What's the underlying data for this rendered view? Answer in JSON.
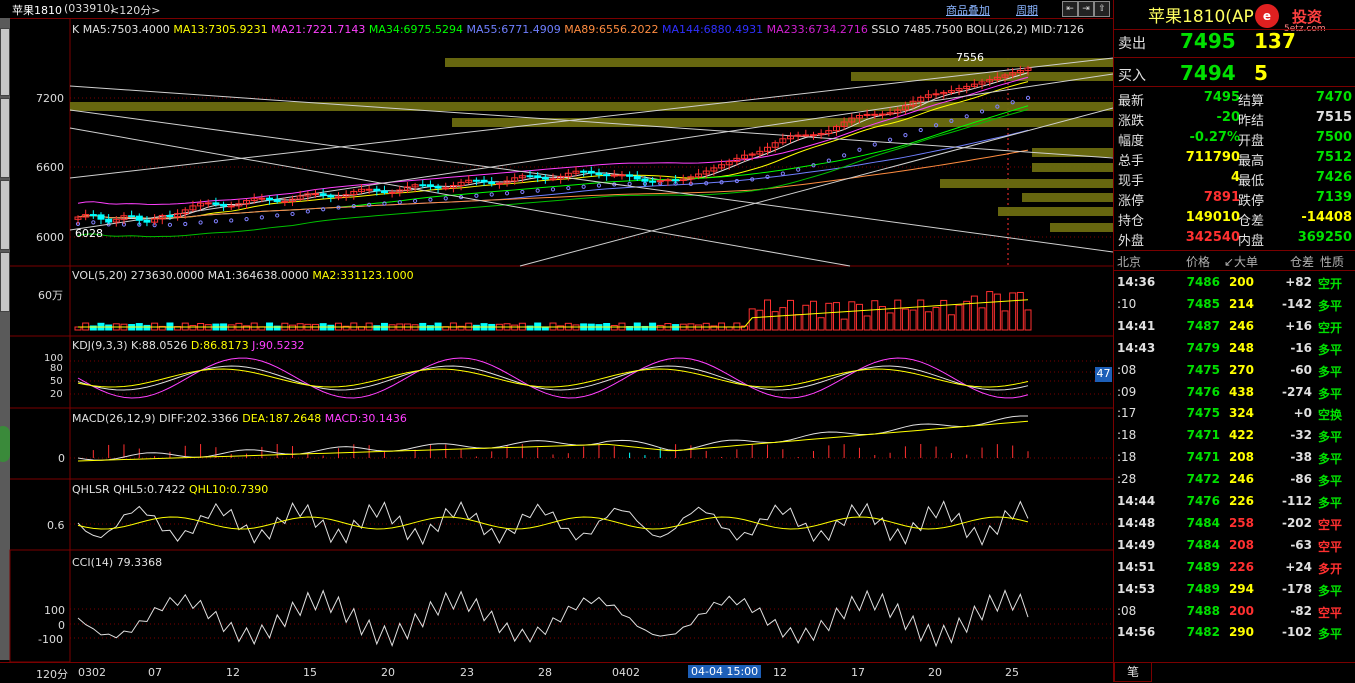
{
  "header": {
    "title": "苹果1810",
    "code": "(033910)",
    "period": "<120分>",
    "overlay_label": "商品叠加",
    "period_label": "周期"
  },
  "main_indicator": {
    "label": "K",
    "items": [
      {
        "text": "MA5:7503.4000",
        "color": "#e0e0e0"
      },
      {
        "text": "MA13:7305.9231",
        "color": "#ffff00"
      },
      {
        "text": "MA21:7221.7143",
        "color": "#ff40ff"
      },
      {
        "text": "MA34:6975.5294",
        "color": "#00ff00"
      },
      {
        "text": "MA55:6771.4909",
        "color": "#6f7fff"
      },
      {
        "text": "MA89:6556.2022",
        "color": "#ff8c40"
      },
      {
        "text": "MA144:6880.4931",
        "color": "#3030ff"
      },
      {
        "text": "MA233:6734.2716",
        "color": "#d020d0"
      },
      {
        "text": "SSLO 7485.7500",
        "color": "#e0e0e0"
      },
      {
        "text": "BOLL(26,2) MID:7126",
        "color": "#e0e0e0"
      }
    ],
    "high_label": "7556",
    "low_label": "6028",
    "y_ticks": [
      "7200",
      "6600",
      "6000"
    ]
  },
  "volume": {
    "title": "VOL(5,20)",
    "items": [
      {
        "text": "273630.0000",
        "color": "#e0e0e0"
      },
      {
        "text": "MA1:364638.0000",
        "color": "#e0e0e0"
      },
      {
        "text": "MA2:331123.1000",
        "color": "#ffff00"
      }
    ],
    "y_tick": "60万"
  },
  "kdj": {
    "title": "KDJ(9,3,3)",
    "items": [
      {
        "text": "K:88.0526",
        "color": "#e0e0e0"
      },
      {
        "text": "D:86.8173",
        "color": "#ffff00"
      },
      {
        "text": "J:90.5232",
        "color": "#ff40ff"
      }
    ],
    "y_ticks": [
      "100",
      "80",
      "50",
      "20"
    ],
    "side_badge": "47"
  },
  "macd": {
    "title": "MACD(26,12,9)",
    "items": [
      {
        "text": "DIFF:202.3366",
        "color": "#e0e0e0"
      },
      {
        "text": "DEA:187.2648",
        "color": "#ffff00"
      },
      {
        "text": "MACD:30.1436",
        "color": "#ff40ff"
      }
    ],
    "y_tick": "0"
  },
  "qhlsr": {
    "title": "QHLSR",
    "items": [
      {
        "text": "QHL5:0.7422",
        "color": "#e0e0e0"
      },
      {
        "text": "QHL10:0.7390",
        "color": "#ffff00"
      }
    ],
    "y_tick": "0.6"
  },
  "cci": {
    "title": "CCI(14)",
    "value": "79.3368",
    "y_ticks": [
      "100",
      "0",
      "-100"
    ]
  },
  "x_axis": {
    "period_label": "120分",
    "labels": [
      "0302",
      "07",
      "12",
      "15",
      "20",
      "23",
      "28",
      "0402",
      "12",
      "17",
      "20",
      "25"
    ],
    "cursor_label": "04-04 15:00"
  },
  "quote": {
    "title": "苹果1810",
    "subtitle": "(AP",
    "brand": "投资",
    "brand_url": "5etz.com",
    "sell_label": "卖出",
    "sell_price": "7495",
    "sell_vol": "137",
    "buy_label": "买入",
    "buy_price": "7494",
    "buy_vol": "5",
    "rows": [
      {
        "l1": "最新",
        "v1": "7495",
        "c1": "g",
        "l2": "结算",
        "v2": "7470",
        "c2": "g"
      },
      {
        "l1": "涨跌",
        "v1": "-20",
        "c1": "g",
        "l2": "昨结",
        "v2": "7515",
        "c2": "w"
      },
      {
        "l1": "幅度",
        "v1": "-0.27%",
        "c1": "g",
        "l2": "开盘",
        "v2": "7500",
        "c2": "g"
      },
      {
        "l1": "总手",
        "v1": "711790",
        "c1": "y",
        "l2": "最高",
        "v2": "7512",
        "c2": "g"
      },
      {
        "l1": "现手",
        "v1": "4",
        "c1": "y",
        "l2": "最低",
        "v2": "7426",
        "c2": "g"
      },
      {
        "l1": "涨停",
        "v1": "7891",
        "c1": "r",
        "l2": "跌停",
        "v2": "7139",
        "c2": "g"
      },
      {
        "l1": "持仓",
        "v1": "149010",
        "c1": "y",
        "l2": "仓差",
        "v2": "-14408",
        "c2": "y"
      },
      {
        "l1": "外盘",
        "v1": "342540",
        "c1": "r",
        "l2": "内盘",
        "v2": "369250",
        "c2": "g"
      }
    ]
  },
  "trades": {
    "headers": [
      "北京",
      "价格",
      "↙大单",
      "仓差",
      "性质"
    ],
    "rows": [
      {
        "time": "14:36",
        "price": "7486",
        "vol": "200",
        "diff": "+82",
        "kind": "空开",
        "vc": "y",
        "kc": "g"
      },
      {
        "time": ":10",
        "price": "7485",
        "vol": "214",
        "diff": "-142",
        "kind": "多平",
        "vc": "y",
        "kc": "g"
      },
      {
        "time": "14:41",
        "price": "7487",
        "vol": "246",
        "diff": "+16",
        "kind": "空开",
        "vc": "y",
        "kc": "g"
      },
      {
        "time": "14:43",
        "price": "7479",
        "vol": "248",
        "diff": "-16",
        "kind": "多平",
        "vc": "y",
        "kc": "g"
      },
      {
        "time": ":08",
        "price": "7475",
        "vol": "270",
        "diff": "-60",
        "kind": "多平",
        "vc": "y",
        "kc": "g"
      },
      {
        "time": ":09",
        "price": "7476",
        "vol": "438",
        "diff": "-274",
        "kind": "多平",
        "vc": "y",
        "kc": "g"
      },
      {
        "time": ":17",
        "price": "7475",
        "vol": "324",
        "diff": "+0",
        "kind": "空换",
        "vc": "y",
        "kc": "g"
      },
      {
        "time": ":18",
        "price": "7471",
        "vol": "422",
        "diff": "-32",
        "kind": "多平",
        "vc": "y",
        "kc": "g"
      },
      {
        "time": ":18",
        "price": "7471",
        "vol": "208",
        "diff": "-38",
        "kind": "多平",
        "vc": "y",
        "kc": "g"
      },
      {
        "time": ":28",
        "price": "7472",
        "vol": "246",
        "diff": "-86",
        "kind": "多平",
        "vc": "y",
        "kc": "g"
      },
      {
        "time": "14:44",
        "price": "7476",
        "vol": "226",
        "diff": "-112",
        "kind": "多平",
        "vc": "y",
        "kc": "g"
      },
      {
        "time": "14:48",
        "price": "7484",
        "vol": "258",
        "diff": "-202",
        "kind": "空平",
        "vc": "r",
        "kc": "r"
      },
      {
        "time": "14:49",
        "price": "7484",
        "vol": "208",
        "diff": "-63",
        "kind": "空平",
        "vc": "r",
        "kc": "r"
      },
      {
        "time": "14:51",
        "price": "7489",
        "vol": "226",
        "diff": "+24",
        "kind": "多开",
        "vc": "r",
        "kc": "r"
      },
      {
        "time": "14:53",
        "price": "7489",
        "vol": "294",
        "diff": "-178",
        "kind": "多平",
        "vc": "y",
        "kc": "g"
      },
      {
        "time": ":08",
        "price": "7488",
        "vol": "200",
        "diff": "-82",
        "kind": "空平",
        "vc": "r",
        "kc": "r"
      },
      {
        "time": "14:56",
        "price": "7482",
        "vol": "290",
        "diff": "-102",
        "kind": "多平",
        "vc": "y",
        "kc": "g"
      }
    ],
    "footer_tab": "笔"
  },
  "colors": {
    "up": "#ff3030",
    "down": "#00ffff",
    "grid": "#7a0000",
    "boll": "#ffffff"
  }
}
